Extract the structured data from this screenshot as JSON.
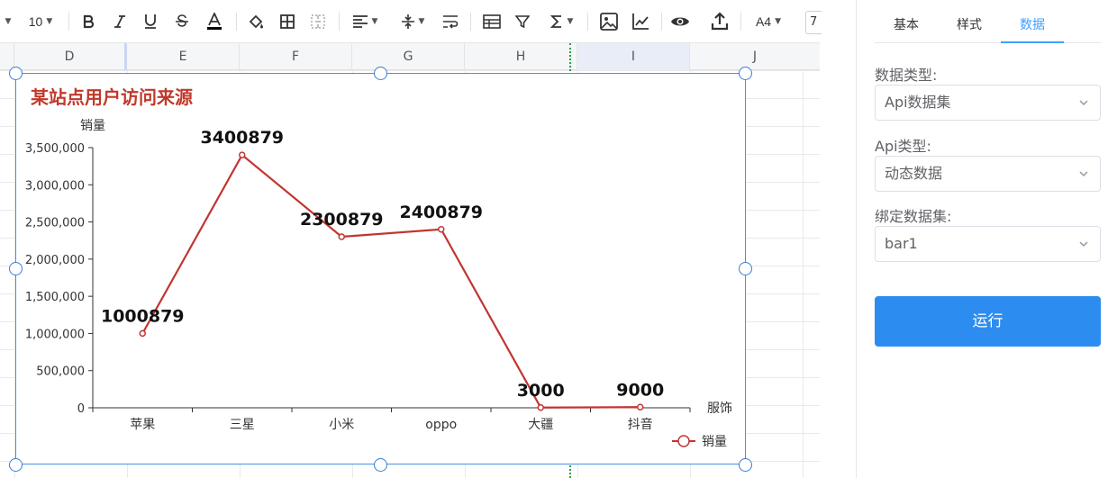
{
  "toolbar": {
    "font_size": "10",
    "page_size": "A4",
    "zoom": "7",
    "icons": [
      "bold-icon",
      "italic-icon",
      "underline-icon",
      "strikethrough-icon",
      "font-color-icon",
      "fill-color-icon",
      "border-icon",
      "merge-cells-icon",
      "align-icon",
      "valign-icon",
      "wrap-icon",
      "table-icon",
      "filter-icon",
      "sum-icon",
      "image-icon",
      "chart-icon",
      "preview-icon",
      "upload-icon"
    ]
  },
  "grid": {
    "columns": [
      "D",
      "E",
      "F",
      "G",
      "H",
      "I",
      "J"
    ],
    "active_column": "I"
  },
  "chart": {
    "title": "某站点用户访问来源"
  },
  "chart_data": {
    "type": "line",
    "title": "某站点用户访问来源",
    "categories": [
      "苹果",
      "三星",
      "小米",
      "oppo",
      "大疆",
      "抖音"
    ],
    "series": [
      {
        "name": "销量",
        "values": [
          1000879,
          3400879,
          2300879,
          2400879,
          3000,
          9000
        ],
        "color": "#c23531"
      }
    ],
    "xlabel": "服饰",
    "ylabel": "销量",
    "ylim": [
      0,
      3500000
    ],
    "yticks": [
      0,
      500000,
      1000000,
      1500000,
      2000000,
      2500000,
      3000000,
      3500000
    ],
    "ytick_labels": [
      "0",
      "500,000",
      "1,000,000",
      "1,500,000",
      "2,000,000",
      "2,500,000",
      "3,000,000",
      "3,500,000"
    ],
    "data_labels": [
      "1000879",
      "3400879",
      "2300879",
      "2400879",
      "3000",
      "9000"
    ],
    "legend": {
      "placement": "bottom-right",
      "entries": [
        "销量"
      ]
    },
    "grid": false
  },
  "panel": {
    "tabs": [
      {
        "label": "基本",
        "active": false
      },
      {
        "label": "样式",
        "active": false
      },
      {
        "label": "数据",
        "active": true
      }
    ],
    "fields": [
      {
        "label": "数据类型:",
        "value": "Api数据集"
      },
      {
        "label": "Api类型:",
        "value": "动态数据"
      },
      {
        "label": "绑定数据集:",
        "value": "bar1"
      }
    ],
    "run_label": "运行"
  },
  "colors": {
    "accent": "#409eff",
    "run_button": "#2d8cf0",
    "title": "#c0392b",
    "series": "#c23531",
    "selection": "#4a90e2",
    "page_break": "#2e9b45"
  }
}
